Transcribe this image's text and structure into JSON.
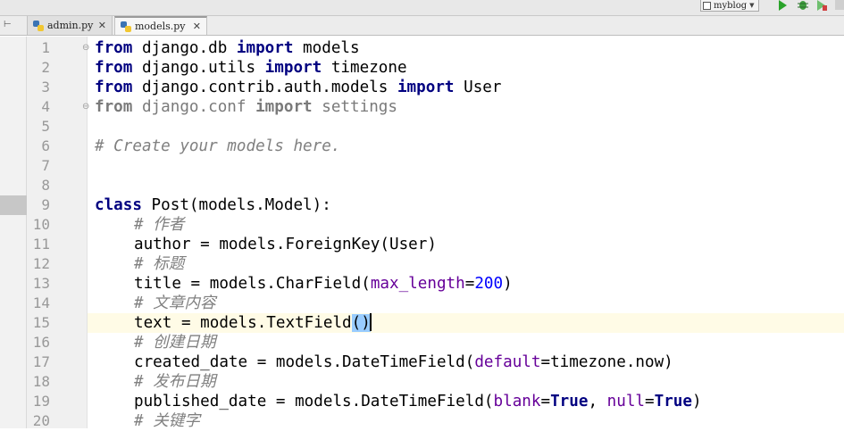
{
  "toolbar": {
    "run_config": "myblog",
    "icons": [
      "run-icon",
      "debug-icon",
      "coverage-icon",
      "stop-icon"
    ]
  },
  "tabs": [
    {
      "label": "admin.py",
      "active": false,
      "icon": "python-file-icon"
    },
    {
      "label": "models.py",
      "active": true,
      "icon": "python-file-icon"
    }
  ],
  "editor": {
    "caret_line": 15,
    "lines": [
      {
        "n": "1"
      },
      {
        "n": "2"
      },
      {
        "n": "3"
      },
      {
        "n": "4"
      },
      {
        "n": "5"
      },
      {
        "n": "6"
      },
      {
        "n": "7"
      },
      {
        "n": "8"
      },
      {
        "n": "9"
      },
      {
        "n": "10"
      },
      {
        "n": "11"
      },
      {
        "n": "12"
      },
      {
        "n": "13"
      },
      {
        "n": "14"
      },
      {
        "n": "15"
      },
      {
        "n": "16"
      },
      {
        "n": "17"
      },
      {
        "n": "18"
      },
      {
        "n": "19"
      },
      {
        "n": "20"
      }
    ],
    "code": {
      "l1": {
        "k1": "from",
        "a": " django.db ",
        "k2": "import",
        "b": " models"
      },
      "l2": {
        "k1": "from",
        "a": " django.utils ",
        "k2": "import",
        "b": " timezone"
      },
      "l3": {
        "k1": "from",
        "a": " django.contrib.auth.models ",
        "k2": "import",
        "b": " User"
      },
      "l4": {
        "k1": "from",
        "a": " django.conf ",
        "k2": "import",
        "b": " settings"
      },
      "l6": {
        "c": "# Create your models here."
      },
      "l9": {
        "k": "class",
        "a": " Post(models.Model):"
      },
      "l10": {
        "c": "# 作者"
      },
      "l11": {
        "a": "author = models.ForeignKey(User)"
      },
      "l12": {
        "c": "# 标题"
      },
      "l13": {
        "a": "title = models.CharField(",
        "p": "max_length",
        "e": "=",
        "n": "200",
        "z": ")"
      },
      "l14": {
        "c": "# 文章内容"
      },
      "l15": {
        "a": "text = models.TextField",
        "h": "()"
      },
      "l16": {
        "c": "# 创建日期"
      },
      "l17": {
        "a": "created_date = models.DateTimeField(",
        "p": "default",
        "b": "=timezone.now)"
      },
      "l18": {
        "c": "# 发布日期"
      },
      "l19": {
        "a": "published_date = models.DateTimeField(",
        "p1": "blank",
        "e1": "=",
        "v1": "True",
        "s": ", ",
        "p2": "null",
        "e2": "=",
        "v2": "True",
        "z": ")"
      },
      "l20": {
        "c": "# 关键字"
      }
    }
  }
}
